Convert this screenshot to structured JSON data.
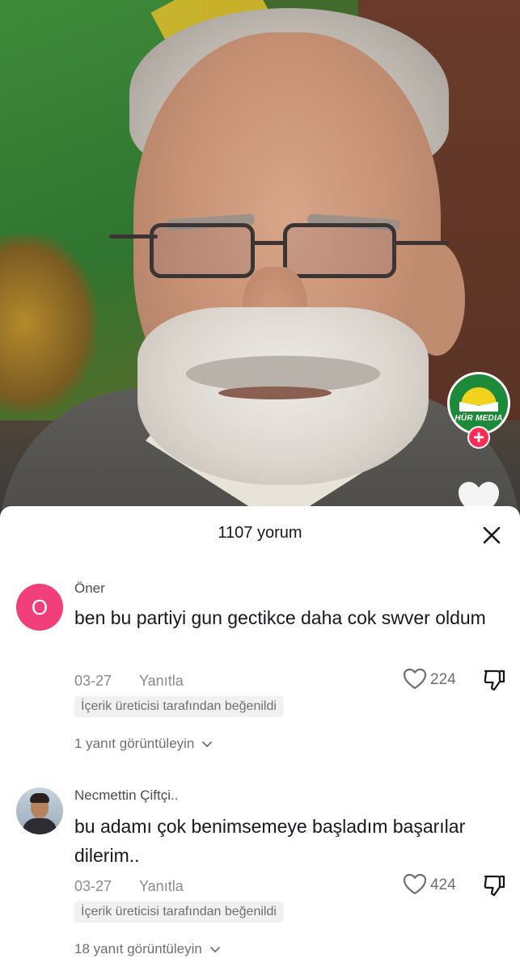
{
  "video": {
    "channel_name": "HÜR MEDIA"
  },
  "comments_sheet": {
    "title": "1107 yorum",
    "comments": [
      {
        "avatar_letter": "O",
        "author": "Öner",
        "text": "ben bu partiyi gun gectikce daha cok swver oldum",
        "date": "03-27",
        "reply_label": "Yanıtla",
        "likes": "224",
        "creator_badge": "İçerik üreticisi tarafından beğenildi",
        "view_replies": "1 yanıt görüntüleyin"
      },
      {
        "author": "Necmettin Çiftçi..",
        "text": "bu adamı çok benimsemeye başladım başarılar dilerim..",
        "date": "03-27",
        "reply_label": "Yanıtla",
        "likes": "424",
        "creator_badge": "İçerik üreticisi tarafından beğenildi",
        "view_replies": "18 yanıt görüntüleyin"
      }
    ]
  },
  "colors": {
    "avatar_pink": "#f13f79",
    "follow_red": "#fe2c55",
    "channel_green": "#1d8a3a"
  }
}
